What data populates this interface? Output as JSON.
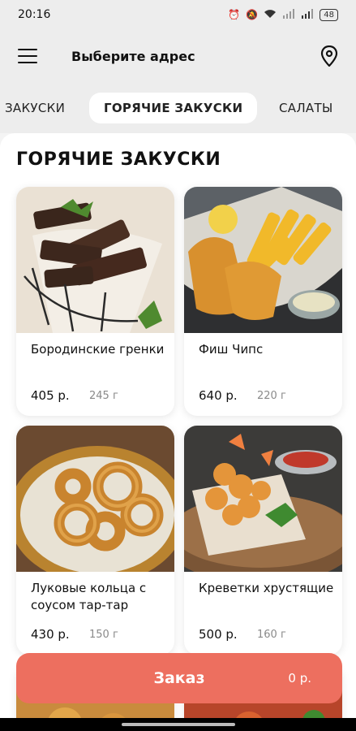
{
  "status": {
    "time": "20:16",
    "battery": "48"
  },
  "header": {
    "address": "Выберите адрес"
  },
  "tabs": [
    {
      "label": "ЗАКУСКИ"
    },
    {
      "label": "ГОРЯЧИЕ ЗАКУСКИ",
      "active": true
    },
    {
      "label": "САЛАТЫ"
    }
  ],
  "section": {
    "title": "ГОРЯЧИЕ ЗАКУСКИ"
  },
  "products": [
    {
      "name": "Бородинские гренки",
      "price": "405 р.",
      "weight": "245 г"
    },
    {
      "name": "Фиш Чипс",
      "price": "640 р.",
      "weight": "220 г"
    },
    {
      "name": "Луковые кольца с соусом тар-тар",
      "price": "430 р.",
      "weight": "150 г"
    },
    {
      "name": "Креветки хрустящие",
      "price": "500 р.",
      "weight": "160 г"
    }
  ],
  "order": {
    "label": "Заказ",
    "total": "0 р."
  },
  "colors": {
    "accent": "#ed6f5f",
    "background": "#ededed"
  }
}
